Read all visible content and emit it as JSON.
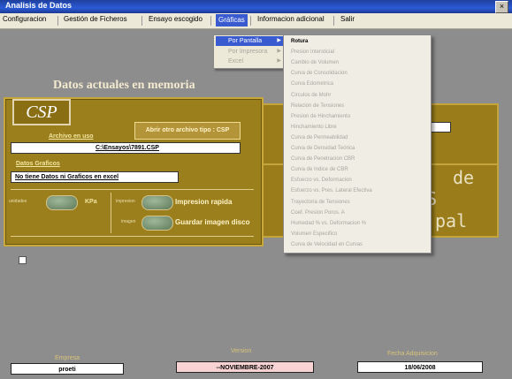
{
  "window": {
    "title": "Analisis de Datos",
    "close_glyph": "×"
  },
  "menubar": [
    {
      "label": "Configuracion"
    },
    {
      "label": "Gestión de Ficheros"
    },
    {
      "label": "Ensayo escogido"
    },
    {
      "label": "Gráficas"
    },
    {
      "label": "Informacion adicional"
    },
    {
      "label": "Salir"
    }
  ],
  "graficas_menu": [
    {
      "label": "Por Pantalla",
      "arrow": "▶"
    },
    {
      "label": "Por Impresora",
      "arrow": "▶"
    },
    {
      "label": "Excel",
      "arrow": "▶"
    }
  ],
  "submenu": [
    "Rotura",
    "Presion Intersticial",
    "Cambio de Volumen",
    "Curva de Consolidacion",
    "Curva Edometrica",
    "Circulos de Mohr",
    "Relacion de Tensiones",
    "Presion de Hinchamiento",
    "Hinchamiento Libre",
    "Curva de Permeabilidad",
    "Curva de Densidad Teórica",
    "Curva de Penetracion CBR",
    "Curva de Indice de CBR",
    "Esfuerzo vs. Deformacion",
    "Esfuerzo vs. Pres. Lateral Efectiva",
    "Trayectoria de Tensiones",
    "Coef. Presion Poros. A",
    "Humedad % vs. Deformacion %",
    "Volumen Especifico",
    "Curva de Velocidad en Curvas"
  ],
  "panel": {
    "heading": "Datos actuales en memoria",
    "csp_label": "CSP",
    "archivo_label": "Archivo en uso",
    "archivo_value": "C:\\Ensayos\\7891.CSP",
    "open_button": "Abrir otro archivo tipo : CSP",
    "datos_label": "Datos Graficos",
    "datos_value": "No tiene Datos ni Graficos en excel",
    "unidades_label": "unidades",
    "kpa_label": "KPa",
    "impresion_small": "impresion",
    "imagen_small": "imagen",
    "impresion_rapida": "Impresion rapida",
    "guardar_imagen": "Guardar imagen disco"
  },
  "background_text": {
    "t1": "de",
    "t2": "S",
    "t3": "pal"
  },
  "footer": {
    "empresa_label": "Empresa",
    "empresa_value": "proeti",
    "version_label": "Version",
    "version_value": "--NOVIEMBRE-2007",
    "fecha_label": "Fecha Adquisicion",
    "fecha_value": "18/06/2008"
  },
  "colors": {
    "panel": "#9c7f1d",
    "menu_highlight": "#3a5ad0",
    "version_bg": "#f7d3d3"
  }
}
